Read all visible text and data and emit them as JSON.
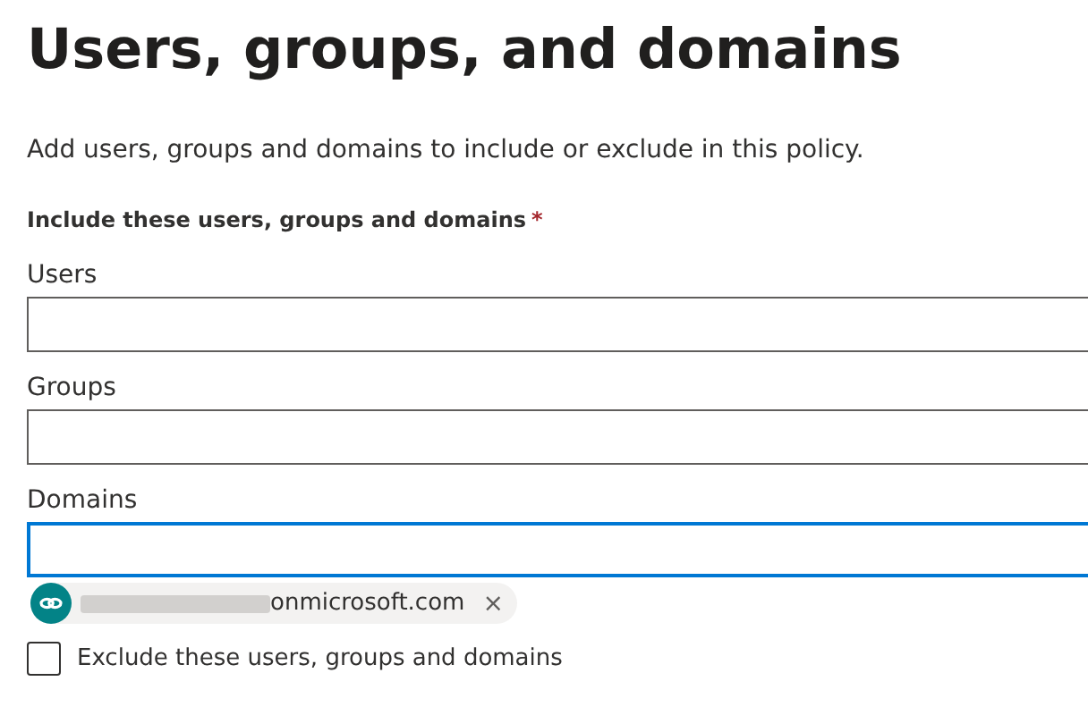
{
  "title": "Users, groups, and domains",
  "description": "Add users, groups and domains to include or exclude in this policy.",
  "section": {
    "label": "Include these users, groups and domains",
    "required_mark": "*"
  },
  "fields": [
    {
      "label": "Users",
      "focused": false
    },
    {
      "label": "Groups",
      "focused": false
    },
    {
      "label": "Domains",
      "focused": true
    }
  ],
  "chips": [
    {
      "text": "onmicrosoft.com",
      "remove": "×"
    }
  ],
  "exclude": {
    "label": "Exclude these users, groups and domains",
    "checked": false
  }
}
